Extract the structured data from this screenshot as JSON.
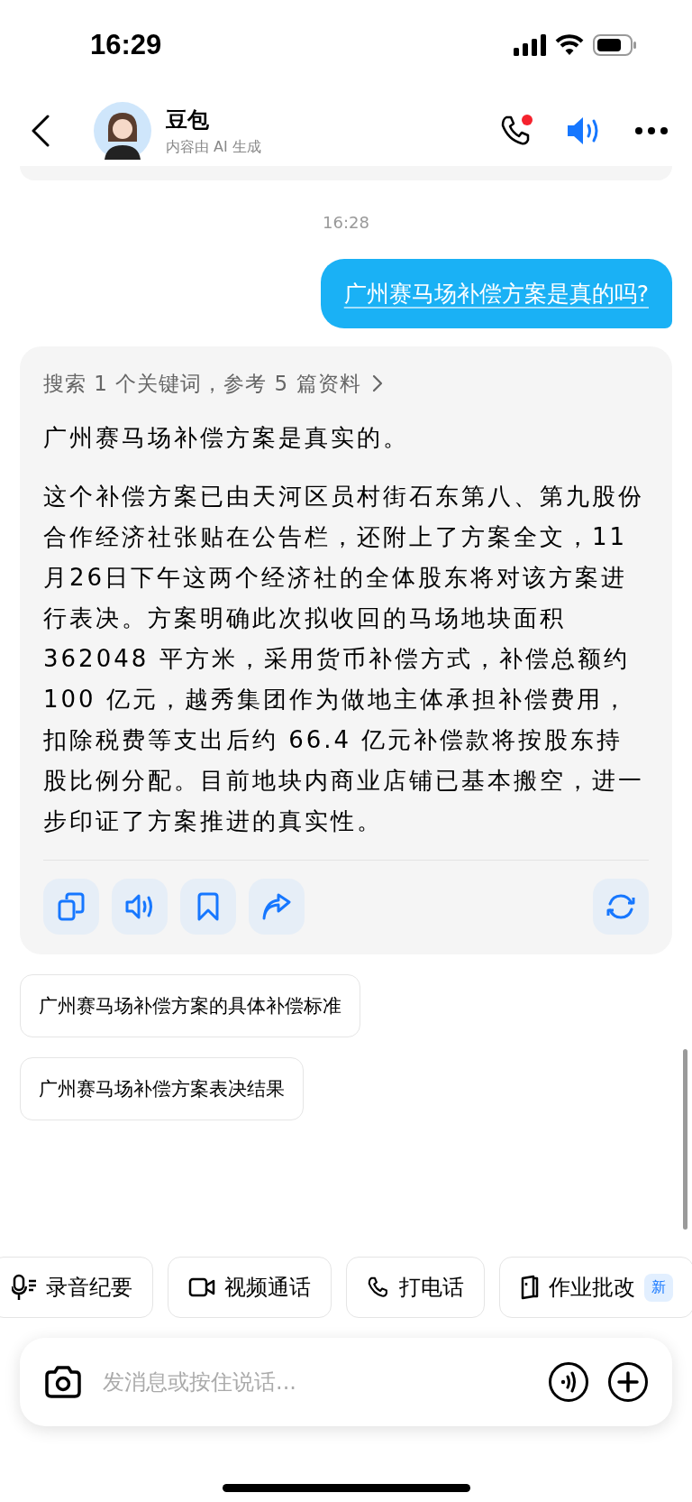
{
  "status_bar": {
    "time": "16:29"
  },
  "header": {
    "name": "豆包",
    "subtitle": "内容由 AI 生成",
    "call_badge": true,
    "speaker_on": true
  },
  "timestamp": "16:28",
  "user_message": "广州赛马场补偿方案是真的吗?",
  "answer": {
    "search_summary": "搜索 1 个关键词，参考 5 篇资料",
    "paragraphs": [
      "广州赛马场补偿方案是真实的。",
      "这个补偿方案已由天河区员村街石东第八、第九股份合作经济社张贴在公告栏，还附上了方案全文，11月26日下午这两个经济社的全体股东将对该方案进行表决。方案明确此次拟收回的马场地块面积 362048 平方米，采用货币补偿方式，补偿总额约 100 亿元，越秀集团作为做地主体承担补偿费用，扣除税费等支出后约 66.4 亿元补偿款将按股东持股比例分配。目前地块内商业店铺已基本搬空，进一步印证了方案推进的真实性。"
    ],
    "actions": [
      {
        "kind": "copy"
      },
      {
        "kind": "speak"
      },
      {
        "kind": "bookmark"
      },
      {
        "kind": "share"
      },
      {
        "kind": "regenerate"
      }
    ]
  },
  "suggestions": [
    "广州赛马场补偿方案的具体补偿标准",
    "广州赛马场补偿方案表决结果"
  ],
  "quick_actions": [
    {
      "kind": "mic",
      "label": "录音纪要"
    },
    {
      "kind": "video",
      "label": "视频通话"
    },
    {
      "kind": "phone",
      "label": "打电话"
    },
    {
      "kind": "homework",
      "label": "作业批改",
      "badge": "新"
    }
  ],
  "input": {
    "placeholder": "发消息或按住说话..."
  }
}
